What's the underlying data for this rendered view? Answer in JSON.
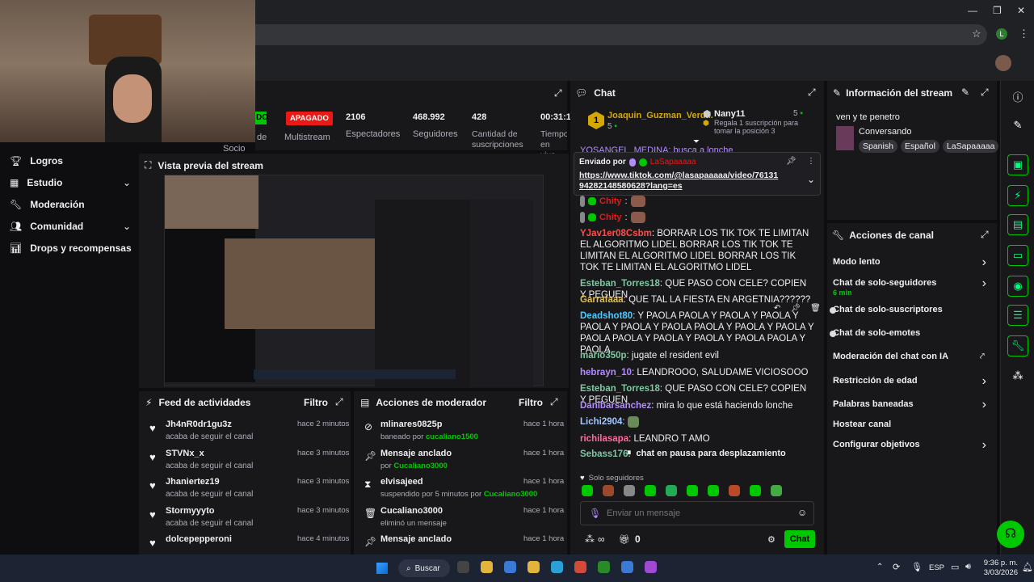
{
  "browser": {
    "profile_initial": "L"
  },
  "sidebar": {
    "items": [
      {
        "label": "Logros",
        "icon": "trophy-icon"
      },
      {
        "label": "Estudio",
        "icon": "grid-icon"
      },
      {
        "label": "Moderación",
        "icon": "wrench-icon"
      },
      {
        "label": "Comunidad",
        "icon": "people-icon"
      },
      {
        "label": "Drops y recompensas",
        "icon": "chart-icon"
      }
    ]
  },
  "stats": {
    "badge_partial": "DO",
    "apagado": "APAGADO",
    "socio": "Socio",
    "de": "de",
    "multistream": "Multistream",
    "viewers_value": "2106",
    "viewers_label": "Espectadores",
    "followers_value": "468.992",
    "followers_label": "Seguidores",
    "subs_value": "428",
    "subs_label": "Cantidad de suscripciones",
    "time_value": "00:31:1",
    "time_label": "Tiempo en vivo"
  },
  "preview": {
    "title": "Vista previa del stream"
  },
  "activity_feed": {
    "title": "Feed de actividades",
    "filter": "Filtro",
    "items": [
      {
        "user": "Jh4nR0dr1gu3z",
        "action": "acaba de seguir el canal",
        "time": "hace 2 minutos"
      },
      {
        "user": "STVNx_x",
        "action": "acaba de seguir el canal",
        "time": "hace 3 minutos"
      },
      {
        "user": "Jhaniertez19",
        "action": "acaba de seguir el canal",
        "time": "hace 3 minutos"
      },
      {
        "user": "Stormyyyto",
        "action": "acaba de seguir el canal",
        "time": "hace 3 minutos"
      },
      {
        "user": "dolcepepperoni",
        "action": "",
        "time": "hace 4 minutos"
      }
    ]
  },
  "mod_actions": {
    "title": "Acciones de moderador",
    "filter": "Filtro",
    "items": [
      {
        "title": "mlinares0825p",
        "pre": "baneado por ",
        "by": "cucaliano1500",
        "time": "hace 1 hora"
      },
      {
        "title": "Mensaje anclado",
        "pre": "por ",
        "by": "Cucaliano3000",
        "time": "hace 1 hora"
      },
      {
        "title": "elvisajeed",
        "pre": "suspendido por 5 minutos por ",
        "by": "Cucaliano3000",
        "time": "hace 1 hora"
      },
      {
        "title": "Cucaliano3000",
        "pre": "eliminó un mensaje",
        "by": "",
        "time": "hace 1 hora"
      },
      {
        "title": "Mensaje anclado",
        "pre": "",
        "by": "",
        "time": "hace 1 hora"
      }
    ]
  },
  "chat": {
    "title": "Chat",
    "leader1_name": "Joaquin_Guzman_Verd...",
    "leader1_count": "5",
    "leader2_name": "Nany11",
    "leader2_count": "5",
    "leader2_desc": "Regala 1 suscripción para tomar la posición 3",
    "top_msg": "YOSANGEL_MEDINA: busca a lonche",
    "pinned_sent_by": "Enviado por",
    "pinned_user": "LaSapaaaaa",
    "pinned_link": "https://www.tiktok.com/@lasapaaaaa/video/7613194282148580628?lang=es",
    "chity": "Chity",
    "messages": [
      {
        "user": "YJav1er08Csbm",
        "color": "#ff4d4d",
        "text": "BORRAR LOS TIK TOK TE LIMITAN EL ALGORITMO LIDEL BORRAR LOS TIK TOK TE LIMITAN EL ALGORITMO LIDEL BORRAR LOS TIK TOK TE LIMITAN EL ALGORITMO LIDEL"
      },
      {
        "user": "Esteban_Torres18",
        "color": "#7ec8a0",
        "text": "QUE PASO CON CELE? COPIEN Y PEGUEN"
      },
      {
        "user": "Garrafaaa",
        "color": "#e2c04f",
        "text": "QUE TAL LA FIESTA EN ARGETNIA??????"
      },
      {
        "user": "Deadshot80",
        "color": "#4ec9ff",
        "text": "Y PAOLA PAOLA Y PAOLA Y PAOLA Y PAOLA Y PAOLA Y PAOLA PAOLA Y PAOLA Y PAOLA Y PAOLA PAOLA Y PAOLA Y PAOLA Y PAOLA PAOLA Y PAOLA"
      },
      {
        "user": "mario350p",
        "color": "#7ec8a0",
        "text": "jugate el resident evil"
      },
      {
        "user": "hebrayn_10",
        "color": "#b58cff",
        "text": "LEANDROOO, SALUDAME VICIOSOOO"
      },
      {
        "user": "Esteban_Torres18",
        "color": "#7ec8a0",
        "text": "QUE PASO CON CELE? COPIEN Y PEGUEN"
      },
      {
        "user": "Danibarsanchez",
        "color": "#b58cff",
        "text": "mira lo que está haciendo lonche"
      },
      {
        "user": "Lichi2904",
        "color": "#a0c8ff",
        "text": ""
      },
      {
        "user": "richilasapa",
        "color": "#ff6b9a",
        "text": "LEANDRO T AMO"
      },
      {
        "user": "Sebass176",
        "color": "#7ec8a0",
        "text": ""
      }
    ],
    "paused": "chat en pausa para desplazamiento",
    "followers_only": "Solo seguidores",
    "input_placeholder": "Enviar un mensaje",
    "points": "0",
    "send": "Chat"
  },
  "stream_info": {
    "title": "Información del stream",
    "stream_title": "ven y te penetro",
    "category": "Conversando",
    "tags": [
      "Spanish",
      "Español",
      "LaSapaaaaa"
    ]
  },
  "channel_actions": {
    "title": "Acciones de canal",
    "items": [
      {
        "label": "Modo lento",
        "sub": "",
        "control": "chevron"
      },
      {
        "label": "Chat de solo-seguidores",
        "sub": "6 min",
        "control": "chevron"
      },
      {
        "label": "Chat de solo-suscriptores",
        "sub": "",
        "control": "toggle"
      },
      {
        "label": "Chat de solo-emotes",
        "sub": "",
        "control": "toggle"
      },
      {
        "label": "Moderación del chat con IA",
        "sub": "",
        "control": "external"
      },
      {
        "label": "Restricción de edad",
        "sub": "",
        "control": "chevron"
      },
      {
        "label": "Palabras baneadas",
        "sub": "",
        "control": "chevron"
      },
      {
        "label": "Hostear canal",
        "sub": "",
        "control": "none"
      },
      {
        "label": "Configurar objetivos",
        "sub": "",
        "control": "chevron"
      }
    ]
  },
  "taskbar": {
    "search": "Buscar",
    "lang": "ESP",
    "time": "9:36 p. m.",
    "date": "3/03/2026"
  },
  "colors": {
    "accent": "#00c800",
    "danger": "#e91916",
    "bg": "#0e0e10",
    "panel": "#18181b"
  }
}
